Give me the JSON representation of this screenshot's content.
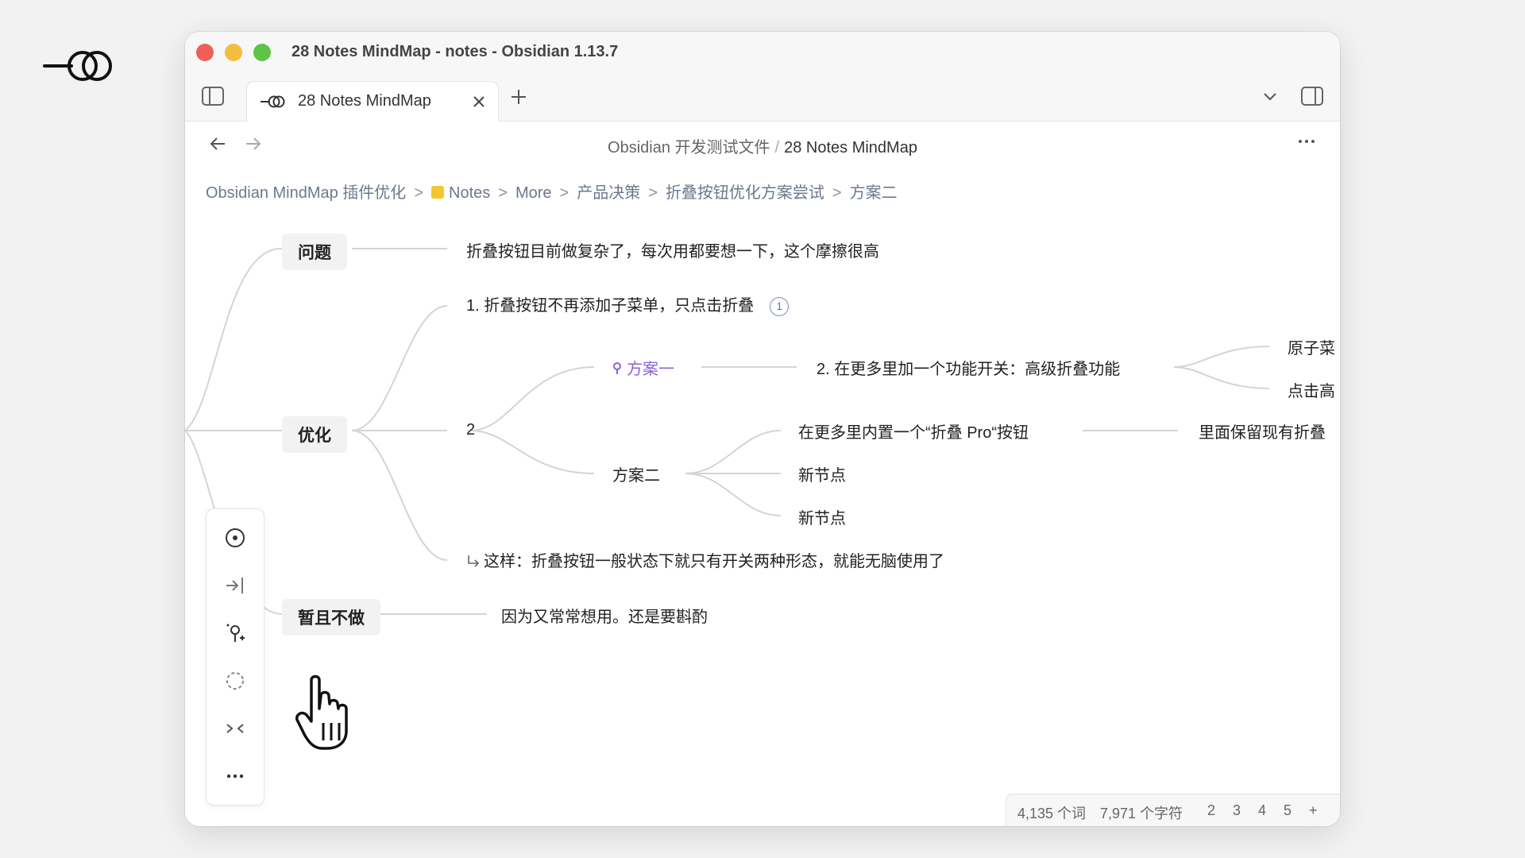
{
  "window": {
    "title": "28 Notes MindMap - notes - Obsidian 1.13.7"
  },
  "tabs": [
    {
      "label": "28 Notes MindMap",
      "icon": "mindmap-icon",
      "active": true
    }
  ],
  "nav": {
    "path_folder": "Obsidian 开发测试文件",
    "path_separator": "/",
    "path_current": "28 Notes MindMap"
  },
  "breadcrumb": [
    "Obsidian MindMap 插件优化",
    "Notes",
    "More",
    "产品决策",
    "折叠按钮优化方案尝试",
    "方案二"
  ],
  "breadcrumb_separator": ">",
  "mindmap": {
    "problem": {
      "label": "问题",
      "child": "折叠按钮目前做复杂了，每次用都要想一下，这个摩擦很高"
    },
    "optimize": {
      "label": "优化",
      "item1": "1. 折叠按钮不再添加子菜单，只点击折叠",
      "item1_badge": "1",
      "item2": "2",
      "plan1": "方案一",
      "plan1_child": "2. 在更多里加一个功能开关：高级折叠功能",
      "plan1_leaf_a": "原子菜",
      "plan1_leaf_b": "点击高",
      "plan2": "方案二",
      "plan2_child_a": "在更多里内置一个“折叠 Pro“按钮",
      "plan2_child_a_leaf": "里面保留现有折叠",
      "plan2_child_b": "新节点",
      "plan2_child_c": "新节点",
      "summary": "这样：折叠按钮一般状态下就只有开关两种形态，就能无脑使用了"
    },
    "later": {
      "label": "暂且不做",
      "child": "因为又常常想用。还是要斟酌"
    }
  },
  "toolbox": [
    "focus-center-icon",
    "export-icon",
    "add-pin-icon",
    "select-area-icon",
    "collapse-icon",
    "more-icon"
  ],
  "status": {
    "words": "4,135 个词",
    "chars": "7,971 个字符",
    "pages": [
      "2",
      "3",
      "4",
      "5",
      "+"
    ]
  },
  "colors": {
    "accent_purple": "#8a62d8",
    "link_blue_gray": "#6c7891",
    "node_bg": "#f2f2f2",
    "branch_line": "#d4d4d4"
  }
}
